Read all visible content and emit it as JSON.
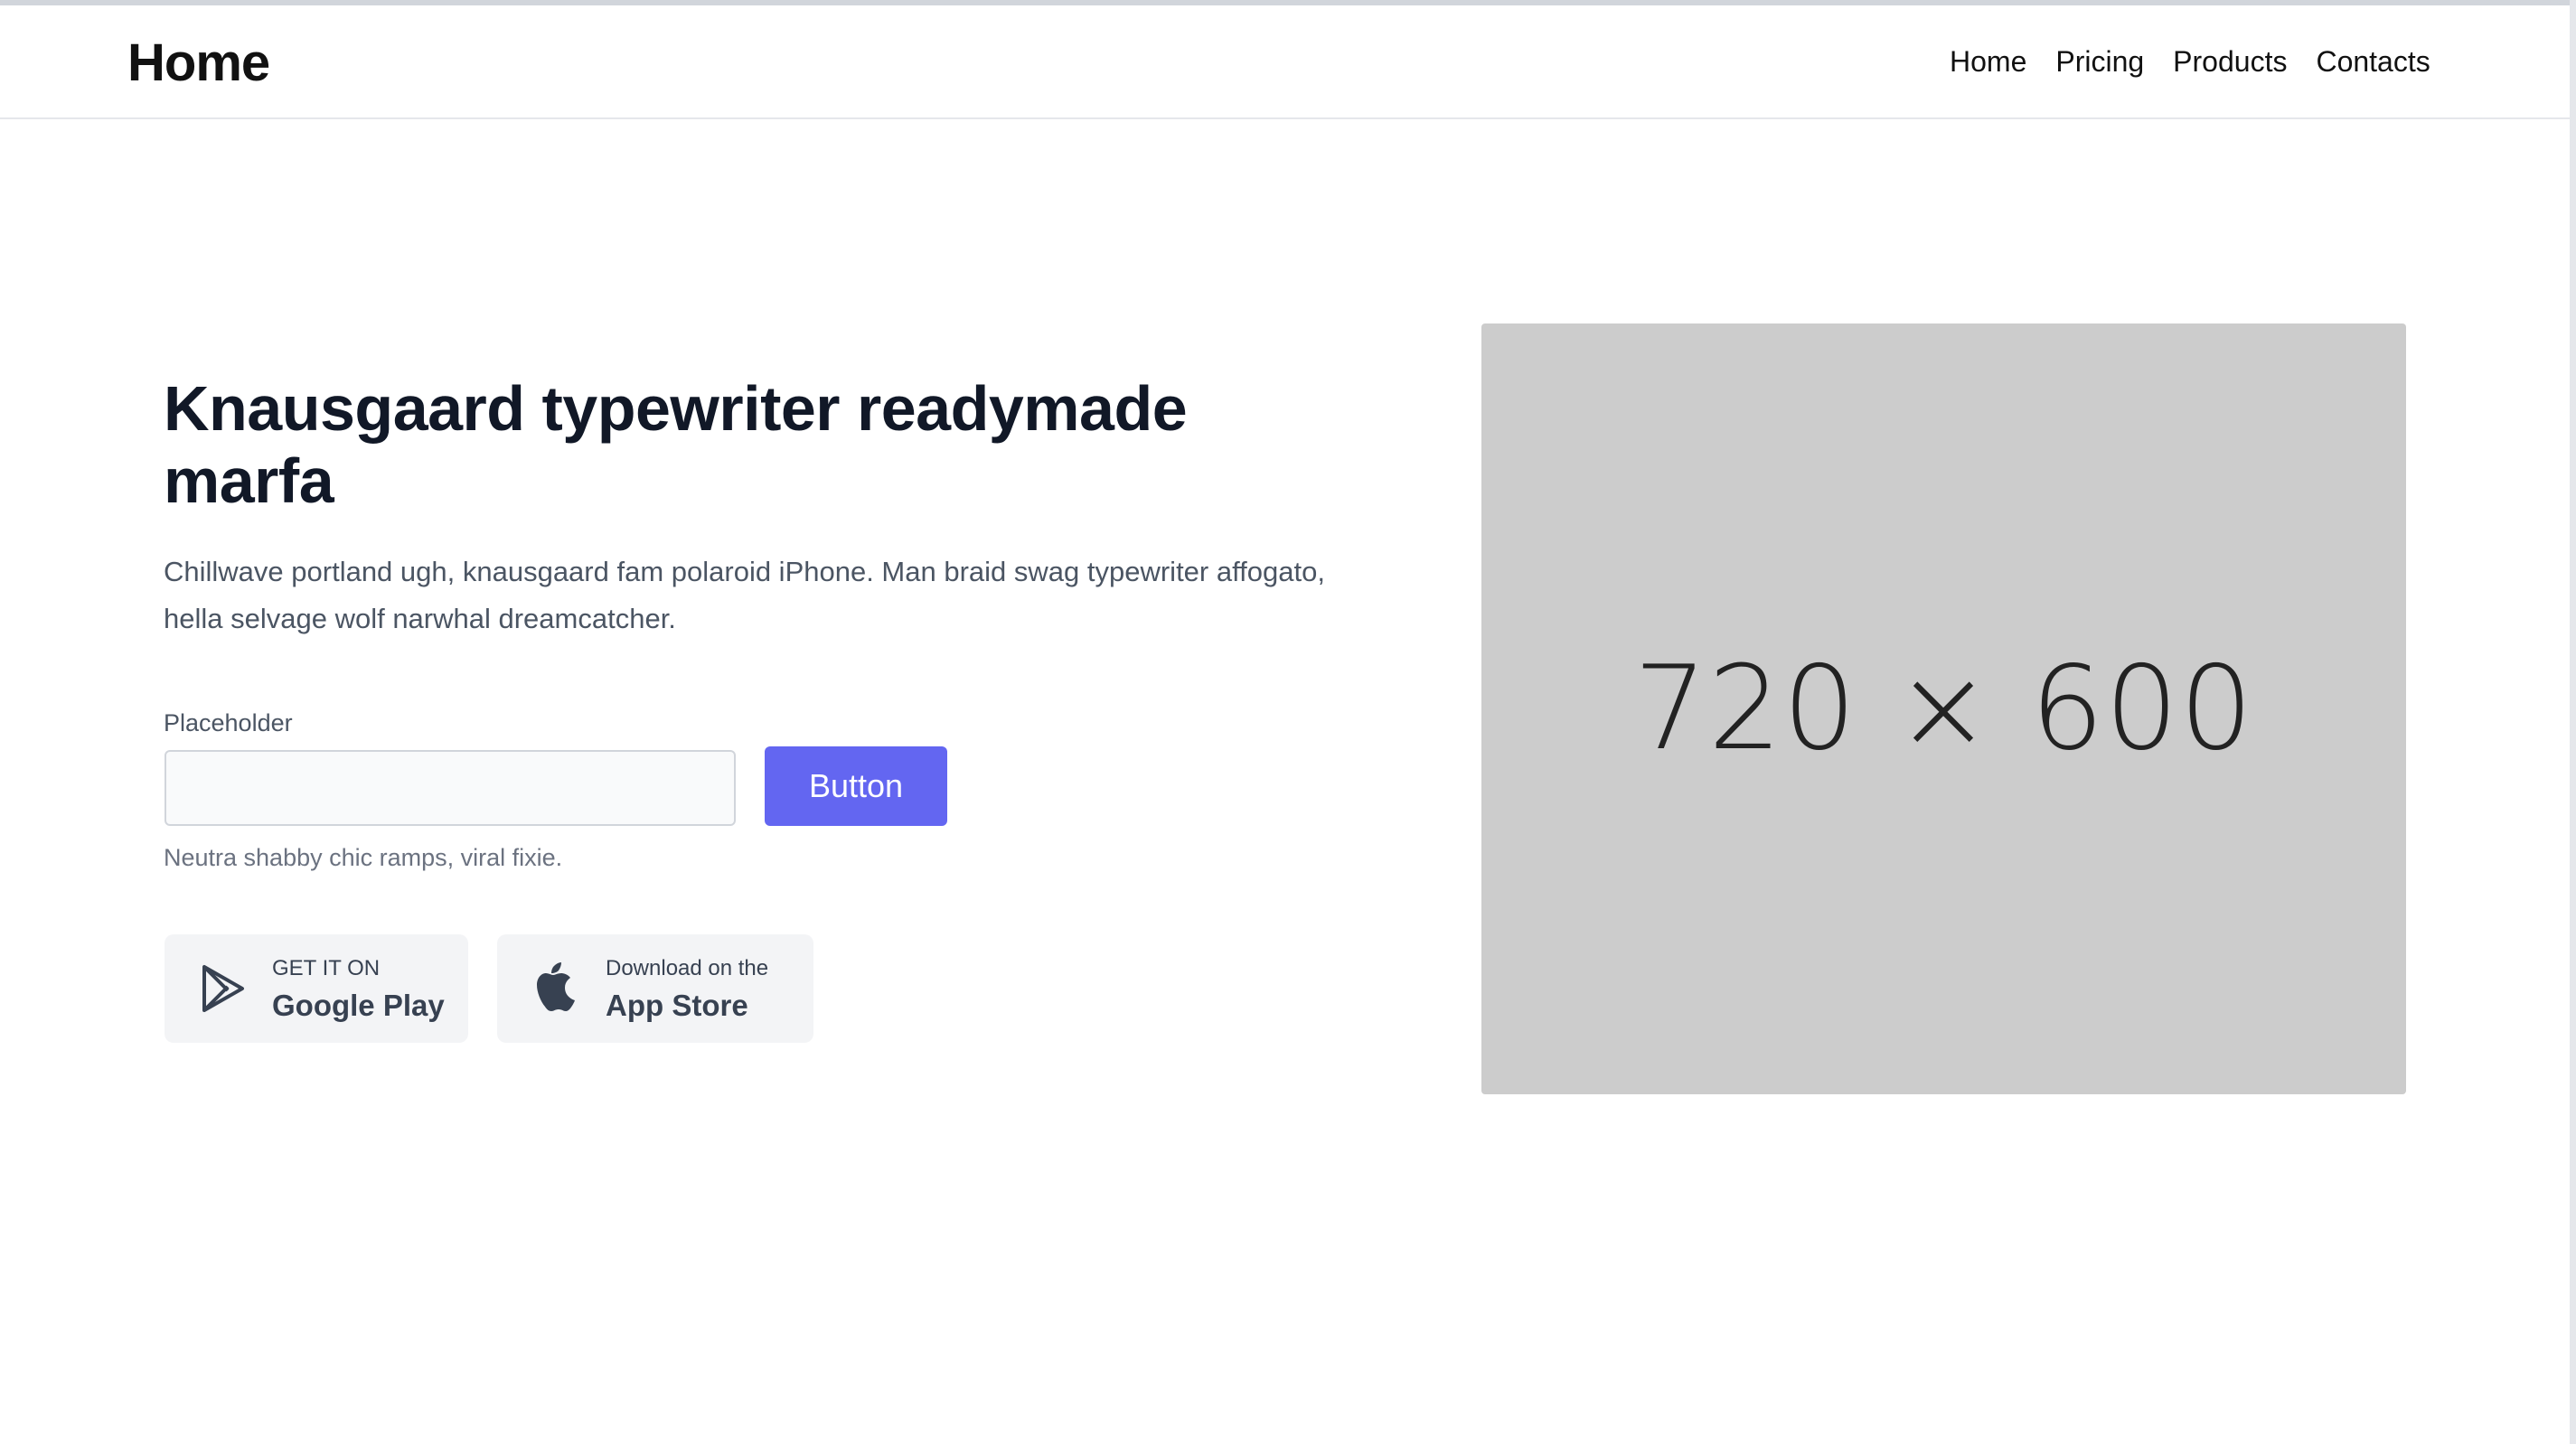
{
  "header": {
    "brand": "Home",
    "nav": [
      "Home",
      "Pricing",
      "Products",
      "Contacts"
    ]
  },
  "hero": {
    "title": "Knausgaard typewriter readymade marfa",
    "description": "Chillwave portland ugh, knausgaard fam polaroid iPhone. Man braid swag typewriter affogato, hella selvage wolf narwhal dreamcatcher.",
    "field_label": "Placeholder",
    "input_value": "",
    "button_label": "Button",
    "helper_text": "Neutra shabby chic ramps, viral fixie.",
    "image_placeholder": "720 × 600"
  },
  "stores": {
    "google": {
      "small": "GET IT ON",
      "big": "Google Play",
      "icon": "google-play-icon"
    },
    "apple": {
      "small": "Download on the",
      "big": "App Store",
      "icon": "apple-icon"
    }
  },
  "colors": {
    "accent": "#6366f1",
    "image_bg": "#cccccc",
    "store_bg": "#f3f4f6"
  }
}
